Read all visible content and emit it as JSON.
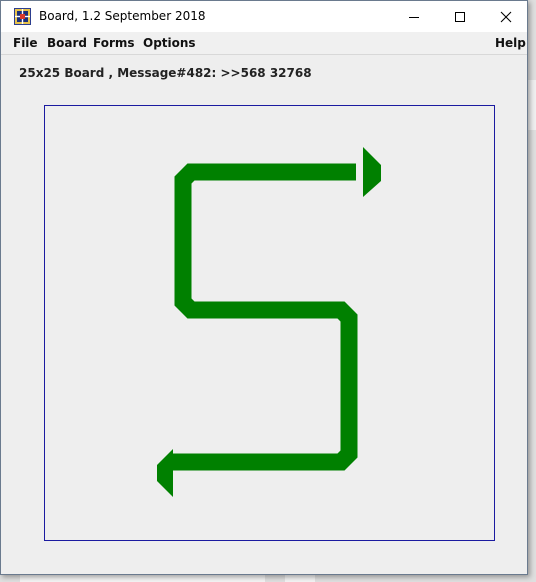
{
  "window": {
    "title": "Board, 1.2 September 2018",
    "icons": {
      "app": "board-grid-icon",
      "minimize": "minimize-icon",
      "maximize": "maximize-icon",
      "close": "close-icon"
    }
  },
  "menu": {
    "file": "File",
    "board": "Board",
    "forms": "Forms",
    "options": "Options",
    "help": "Help"
  },
  "status": {
    "text": "25x25 Board , Message#482: >>568 32768"
  },
  "board": {
    "border_color": "#1a1aa0",
    "shape_color": "#008000",
    "shape": "S-shaped double arrow",
    "icons": [
      "arrow-right-icon",
      "arrow-left-icon"
    ]
  }
}
